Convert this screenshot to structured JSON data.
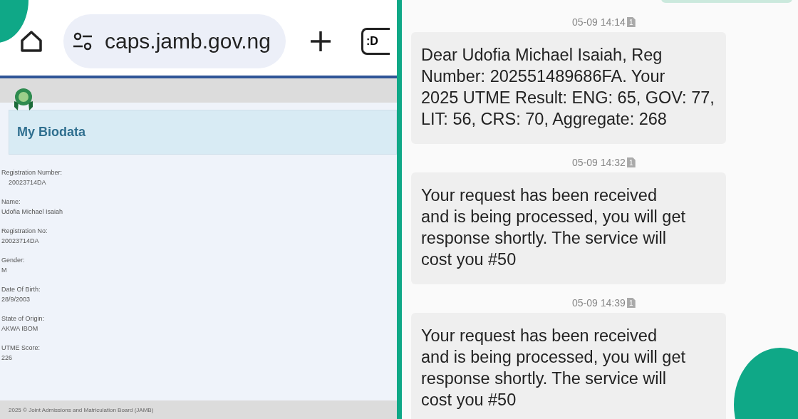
{
  "browser": {
    "url": "caps.jamb.gov.ng",
    "tab_badge": ":D"
  },
  "biodata": {
    "title": "My Biodata",
    "fields": [
      {
        "label": "Registration Number:",
        "value": "20023714DA",
        "indented": true
      },
      {
        "label": "Name:",
        "value": "Udofia Michael Isaiah",
        "indented": false
      },
      {
        "label": "Registration No:",
        "value": "20023714DA",
        "indented": false
      },
      {
        "label": "Gender:",
        "value": "M",
        "indented": false
      },
      {
        "label": "Date Of Birth:",
        "value": "28/9/2003",
        "indented": false
      },
      {
        "label": "State of Origin:",
        "value": "AKWA IBOM",
        "indented": false
      },
      {
        "label": "UTME Score:",
        "value": "226",
        "indented": false
      }
    ],
    "footer": "2025 © Joint Admissions and Matriculation Board (JAMB)"
  },
  "messages": [
    {
      "time": "05-09 14:14",
      "sim": "1",
      "lines": [
        "Dear Udofia Michael Isaiah, Reg",
        "Number: 202551489686FA. Your",
        "2025 UTME Result: ENG: 65, GOV: 77,",
        "LIT: 56, CRS: 70, Aggregate: 268"
      ]
    },
    {
      "time": "05-09 14:32",
      "sim": "1",
      "lines": [
        "Your request has been received",
        "and is being processed, you will get",
        "response shortly. The service will",
        "cost you #50"
      ]
    },
    {
      "time": "05-09 14:39",
      "sim": "1",
      "lines": [
        "Your request has been received",
        "and is being processed, you will get",
        "response shortly. The service will",
        "cost you #50"
      ]
    }
  ]
}
